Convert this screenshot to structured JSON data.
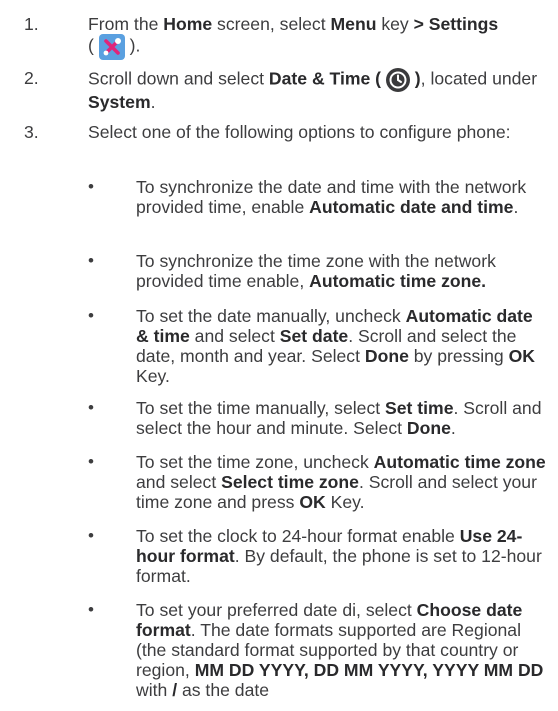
{
  "steps": [
    {
      "num": "1.",
      "parts": [
        "From the ",
        "Home",
        " screen, select ",
        "Menu",
        " key ",
        "> Settings",
        " ( ",
        " )."
      ]
    },
    {
      "num": "2.",
      "parts": [
        "Scroll down and select ",
        "Date & Time ( ",
        " )",
        ", located under ",
        "System",
        "."
      ]
    },
    {
      "num": "3.",
      "parts": [
        "Select one of the following options to configure phone:"
      ]
    }
  ],
  "bullets": [
    {
      "dot": "•",
      "parts": [
        "To synchronize the date and time with the network provided time, enable ",
        "Automatic date and time",
        "."
      ]
    },
    {
      "dot": "•",
      "parts": [
        "To synchronize the time zone with the network provided time enable, ",
        "Automatic time zone."
      ]
    },
    {
      "dot": "•",
      "parts": [
        "To set the date manually, uncheck ",
        "Automatic date & time",
        " and select ",
        "Set date",
        ". Scroll and select the date, month and year. Select ",
        "Done",
        " by pressing ",
        "OK",
        " Key."
      ]
    },
    {
      "dot": "•",
      "parts": [
        "To set the time manually, select ",
        "Set time",
        ". Scroll and select the hour and minute. Select ",
        "Done",
        "."
      ]
    },
    {
      "dot": "•",
      "parts": [
        "To set the time zone, uncheck ",
        "Automatic time zone",
        " and select ",
        "Select time zone",
        ". Scroll and select your time zone and press ",
        "OK",
        " Key."
      ]
    },
    {
      "dot": "•",
      "parts": [
        "To set the clock to 24-hour format enable ",
        "Use 24-hour format",
        ". By default, the phone is set to 12-hour format."
      ]
    },
    {
      "dot": "•",
      "parts": [
        "To set your preferred date di, select ",
        "Choose date format",
        ". The date formats supported are Regional (the standard format supported by that country or region, ",
        "MM DD YYYY, DD MM YYYY, YYYY MM DD",
        " with ",
        "/",
        " as the date"
      ]
    }
  ],
  "icons": {
    "settings": "settings-wrench-screwdriver-icon",
    "clock": "clock-icon",
    "settings_color": "#5aa0e0",
    "clock_color": "#3a3a3c"
  }
}
